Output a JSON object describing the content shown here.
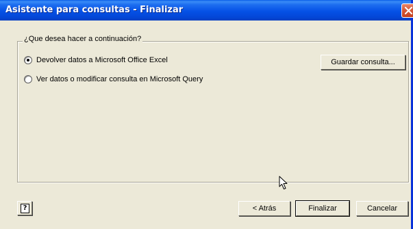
{
  "window": {
    "title": "Asistente para consultas - Finalizar",
    "close_icon": "close-icon"
  },
  "group": {
    "legend": "¿Que desea hacer a continuación?"
  },
  "options": [
    {
      "label": "Devolver datos a Microsoft Office Excel",
      "selected": true
    },
    {
      "label": "Ver datos o modificar consulta en Microsoft Query",
      "selected": false
    }
  ],
  "buttons": {
    "save_query": "Guardar consulta...",
    "back": "< Atrás",
    "finish": "Finalizar",
    "cancel": "Cancelar"
  },
  "help": {
    "icon": "help-icon",
    "glyph": "?"
  },
  "colors": {
    "titlebar": "#0551e6",
    "face": "#ece9d8",
    "close": "#d65a3a"
  }
}
